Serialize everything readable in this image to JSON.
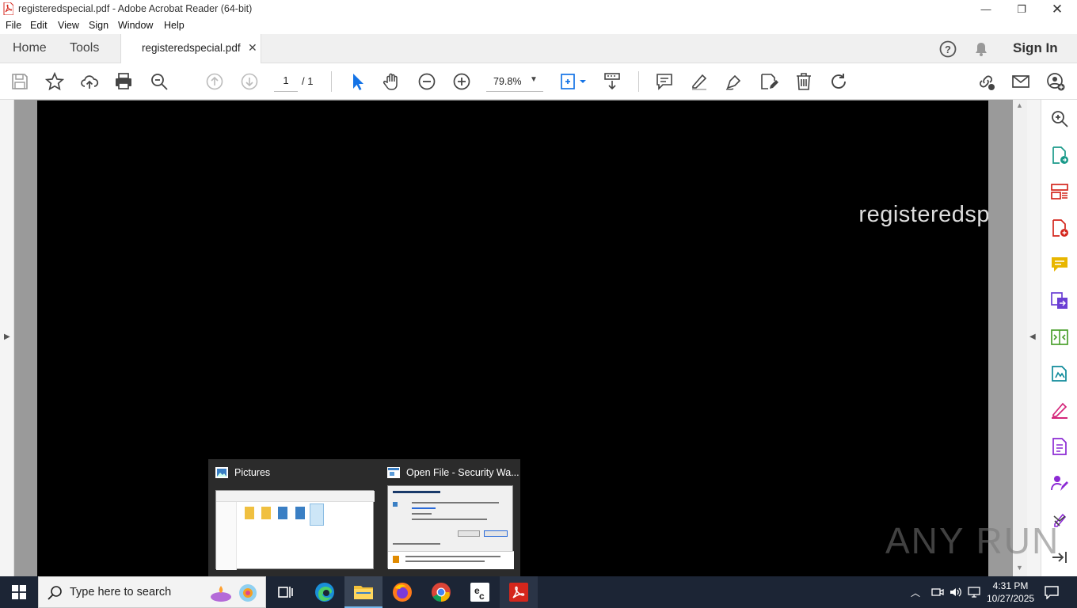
{
  "window": {
    "title": "registeredspecial.pdf - Adobe Acrobat Reader (64-bit)"
  },
  "menu": [
    "File",
    "Edit",
    "View",
    "Sign",
    "Window",
    "Help"
  ],
  "tabs": {
    "home": "Home",
    "tools": "Tools",
    "document": "registeredspecial.pdf"
  },
  "account": {
    "sign_in": "Sign In"
  },
  "toolbar": {
    "page_current": "1",
    "page_total": "/ 1",
    "zoom": "79.8%"
  },
  "document": {
    "visible_text": "registeredsp"
  },
  "taskbar": {
    "search_placeholder": "Type here to search",
    "clock_time": "4:31 PM",
    "clock_date": "10/27/2025"
  },
  "preview": {
    "item1_title": "Pictures",
    "item2_title": "Open File - Security Wa..."
  },
  "watermark": "ANY RUN",
  "colors": {
    "acrobat_red": "#d4261c",
    "toolbar_blue": "#1473e6",
    "taskbar_bg": "#1c2535"
  }
}
